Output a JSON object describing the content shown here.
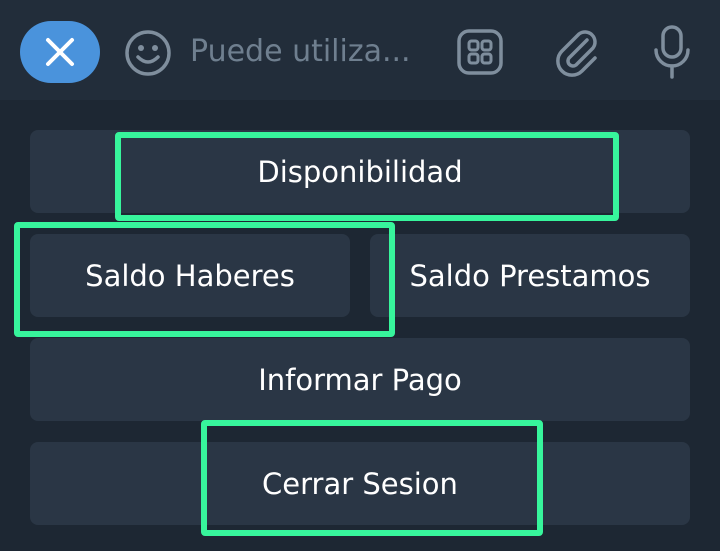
{
  "composer": {
    "input_placeholder": "Puede utiliza...",
    "close_icon": "close-x-icon",
    "emoji_icon": "smiley-icon",
    "bot_commands_icon": "grid-icon",
    "attach_icon": "paperclip-icon",
    "mic_icon": "microphone-icon"
  },
  "reply_keyboard": {
    "buttons": [
      {
        "label": "Disponibilidad"
      },
      {
        "label": "Saldo Haberes"
      },
      {
        "label": "Saldo Prestamos"
      },
      {
        "label": "Informar Pago"
      },
      {
        "label": "Cerrar Sesion"
      }
    ]
  },
  "colors": {
    "accent_close": "#4a93dc",
    "highlight": "#37f59c",
    "background": "#1d2733",
    "key_bg": "#2a3645"
  }
}
